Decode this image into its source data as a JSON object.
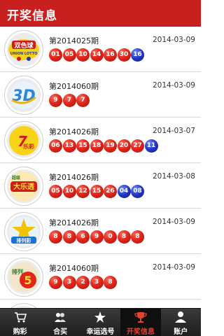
{
  "header": {
    "title": "开奖信息"
  },
  "colors": {
    "header_bg": "#c8201e",
    "red_ball": "#e0261b",
    "blue_ball": "#2136c4",
    "tabbar_bg": "#2a2a2a",
    "active_tab_label": "#e3442f"
  },
  "logos": {
    "0": {
      "icon": "shuangseqiu-logo",
      "text": "双色球",
      "subtext": "UNION LOTTO"
    },
    "1": {
      "icon": "3d-logo",
      "text": "3D"
    },
    "2": {
      "icon": "qilecai-logo",
      "text": "7乐彩"
    },
    "3": {
      "icon": "daletou-logo",
      "text": "大乐透"
    },
    "4": {
      "icon": "pailie-logo",
      "text": "排列彩"
    },
    "5": {
      "icon": "pailie5-logo",
      "text": "5"
    }
  },
  "results": [
    {
      "issue": "第2014025期",
      "date": "2014-03-09",
      "red": [
        "01",
        "05",
        "10",
        "14",
        "16",
        "30"
      ],
      "blue": [
        "16"
      ]
    },
    {
      "issue": "第2014060期",
      "date": "2014-03-09",
      "red": [
        "9",
        "7",
        "7"
      ],
      "blue": []
    },
    {
      "issue": "第2014026期",
      "date": "2014-03-07",
      "red": [
        "06",
        "13",
        "15",
        "18",
        "19",
        "20",
        "27"
      ],
      "blue": [
        "11"
      ]
    },
    {
      "issue": "第2014026期",
      "date": "2014-03-08",
      "red": [
        "05",
        "10",
        "12",
        "15",
        "26"
      ],
      "blue": [
        "04",
        "08"
      ]
    },
    {
      "issue": "第2014026期",
      "date": "2014-03-09",
      "red": [
        "8",
        "8",
        "6",
        "9",
        "0",
        "8",
        "8"
      ],
      "blue": []
    },
    {
      "issue": "第2014060期",
      "date": "2014-03-09",
      "red": [
        "9",
        "3",
        "2",
        "3",
        "8"
      ],
      "blue": []
    }
  ],
  "tabs": [
    {
      "label": "购彩",
      "icon": "cart-icon"
    },
    {
      "label": "合买",
      "icon": "group-icon"
    },
    {
      "label": "幸运选号",
      "icon": "lucky-star-icon"
    },
    {
      "label": "开奖信息",
      "icon": "trophy-icon",
      "active": true
    },
    {
      "label": "账户",
      "icon": "user-icon"
    }
  ]
}
